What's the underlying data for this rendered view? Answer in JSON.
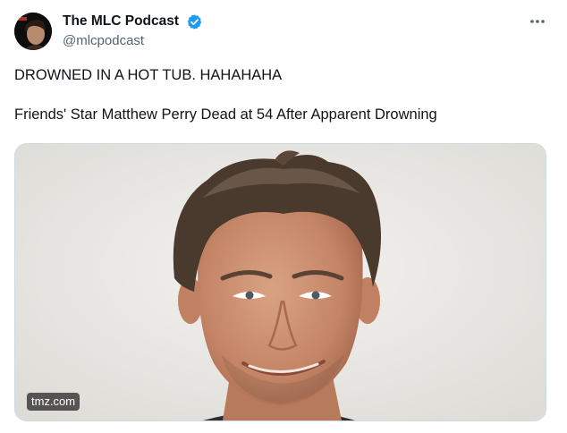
{
  "author": {
    "display_name": "The MLC Podcast",
    "handle": "@mlcpodcast",
    "verified": true,
    "verified_color": "#1d9bf0"
  },
  "tweet": {
    "text": "DROWNED IN A HOT TUB. HAHAHAHA\n\nFriends' Star Matthew Perry Dead at 54 After Apparent Drowning"
  },
  "media": {
    "source_label": "tmz.com",
    "image_subject": "headshot of a smiling man with tousled brown hair"
  },
  "icons": {
    "more": "more-horizontal-icon",
    "verified": "verified-badge-icon"
  }
}
